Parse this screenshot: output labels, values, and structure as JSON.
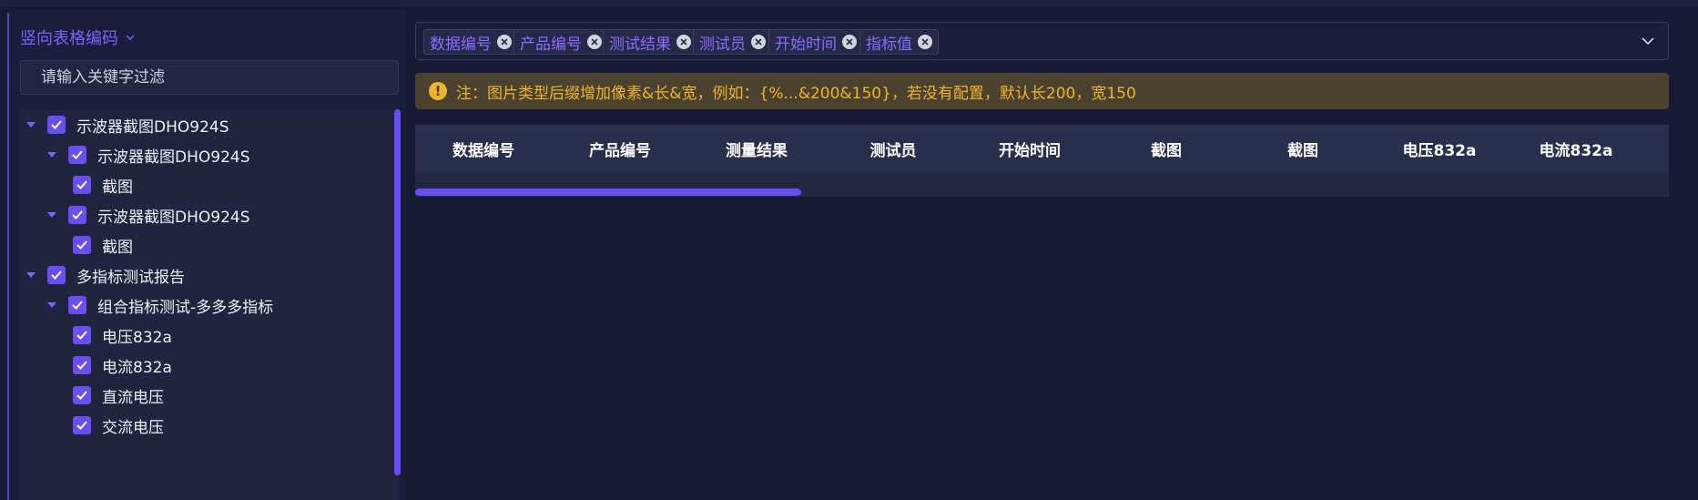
{
  "panel": {
    "title": "竖向表格编码",
    "filter_placeholder": "请输入关键字过滤"
  },
  "tree": {
    "items": [
      {
        "label": "示波器截图DHO924S",
        "level": 0,
        "expandable": true,
        "checked": true
      },
      {
        "label": "示波器截图DHO924S",
        "level": 1,
        "expandable": true,
        "checked": true
      },
      {
        "label": "截图",
        "level": 2,
        "expandable": false,
        "checked": true
      },
      {
        "label": "示波器截图DHO924S",
        "level": 1,
        "expandable": true,
        "checked": true
      },
      {
        "label": "截图",
        "level": 2,
        "expandable": false,
        "checked": true
      },
      {
        "label": "多指标测试报告",
        "level": 0,
        "expandable": true,
        "checked": true
      },
      {
        "label": "组合指标测试-多多多指标",
        "level": 1,
        "expandable": true,
        "checked": true
      },
      {
        "label": "电压832a",
        "level": 2,
        "expandable": false,
        "checked": true
      },
      {
        "label": "电流832a",
        "level": 2,
        "expandable": false,
        "checked": true
      },
      {
        "label": "直流电压",
        "level": 2,
        "expandable": false,
        "checked": true
      },
      {
        "label": "交流电压",
        "level": 2,
        "expandable": false,
        "checked": true
      }
    ]
  },
  "tags": [
    "数据编号",
    "产品编号",
    "测试结果",
    "测试员",
    "开始时间",
    "指标值"
  ],
  "notice": {
    "icon": "warning-icon",
    "text": "注：图片类型后缀增加像素&长&宽，例如：{%...&200&150}，若没有配置，默认长200，宽150"
  },
  "table": {
    "columns": [
      "数据编号",
      "产品编号",
      "测量结果",
      "测试员",
      "开始时间",
      "截图",
      "截图",
      "电压832a",
      "电流832a"
    ]
  },
  "colors": {
    "accent": "#6b4cf2",
    "background": "#161a35",
    "warning": "#f0b429"
  }
}
